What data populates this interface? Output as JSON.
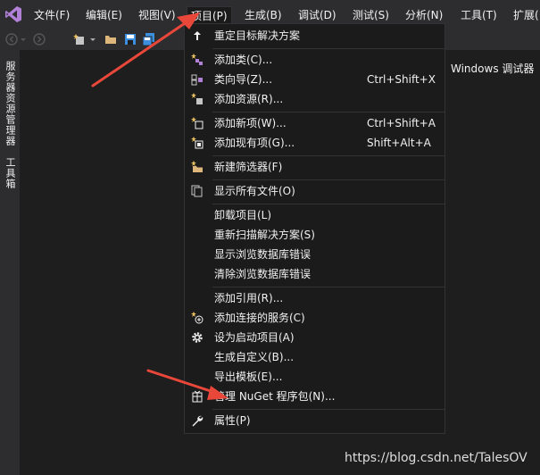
{
  "menubar": {
    "items": [
      "文件(F)",
      "编辑(E)",
      "视图(V)",
      "项目(P)",
      "生成(B)",
      "调试(D)",
      "测试(S)",
      "分析(N)",
      "工具(T)",
      "扩展("
    ]
  },
  "toolbar": {
    "debug_target": "Windows 调试器"
  },
  "sidebar": {
    "tabs": [
      "服务器资源管理器",
      "工具箱"
    ]
  },
  "project_menu": {
    "items": [
      {
        "label": "重定目标解决方案",
        "shortcut": "",
        "icon": "retarget-arrow-icon"
      },
      {
        "label": "添加类(C)...",
        "shortcut": "",
        "icon": "add-class-icon"
      },
      {
        "label": "类向导(Z)...",
        "shortcut": "Ctrl+Shift+X",
        "icon": "class-wizard-icon"
      },
      {
        "label": "添加资源(R)...",
        "shortcut": "",
        "icon": "add-resource-icon"
      },
      {
        "label": "添加新项(W)...",
        "shortcut": "Ctrl+Shift+A",
        "icon": "add-new-item-icon"
      },
      {
        "label": "添加现有项(G)...",
        "shortcut": "Shift+Alt+A",
        "icon": "add-existing-item-icon"
      },
      {
        "label": "新建筛选器(F)",
        "shortcut": "",
        "icon": "new-filter-folder-icon"
      },
      {
        "label": "显示所有文件(O)",
        "shortcut": "",
        "icon": "show-all-files-icon"
      },
      {
        "label": "卸载项目(L)",
        "shortcut": "",
        "icon": ""
      },
      {
        "label": "重新扫描解决方案(S)",
        "shortcut": "",
        "icon": ""
      },
      {
        "label": "显示浏览数据库错误",
        "shortcut": "",
        "icon": ""
      },
      {
        "label": "清除浏览数据库错误",
        "shortcut": "",
        "icon": ""
      },
      {
        "label": "添加引用(R)...",
        "shortcut": "",
        "icon": ""
      },
      {
        "label": "添加连接的服务(C)",
        "shortcut": "",
        "icon": "connected-service-icon"
      },
      {
        "label": "设为启动项目(A)",
        "shortcut": "",
        "icon": "gear-icon"
      },
      {
        "label": "生成自定义(B)...",
        "shortcut": "",
        "icon": ""
      },
      {
        "label": "导出模板(E)...",
        "shortcut": "",
        "icon": ""
      },
      {
        "label": "管理 NuGet 程序包(N)...",
        "shortcut": "",
        "icon": "nuget-package-icon"
      },
      {
        "label": "属性(P)",
        "shortcut": "",
        "icon": "wrench-icon"
      }
    ]
  },
  "watermark": "https://blog.csdn.net/TalesOV",
  "colors": {
    "menubar_bg": "#2d2d30",
    "menu_bg": "#1b1b1c",
    "accent_purple": "#68217a",
    "arrow_red": "#e8473a"
  }
}
